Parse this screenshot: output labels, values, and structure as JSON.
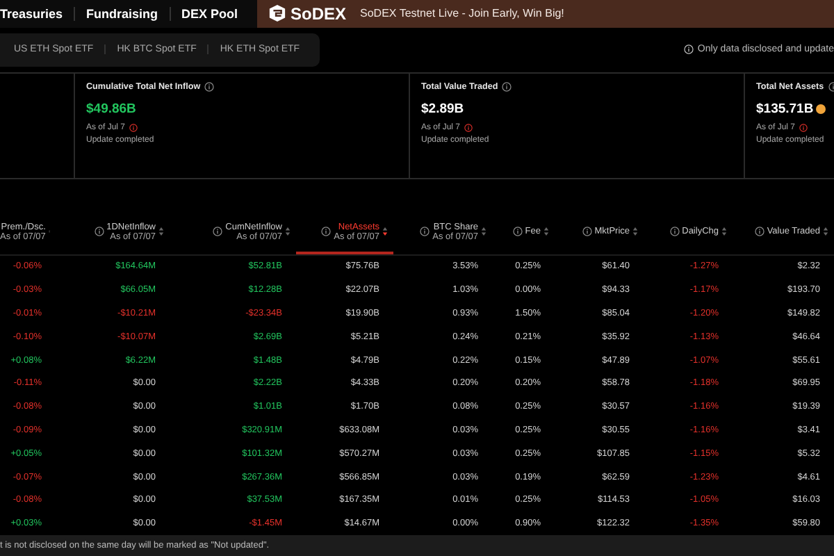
{
  "nav": {
    "items": [
      "Treasuries",
      "Fundraising",
      "DEX Pool"
    ]
  },
  "banner": {
    "brand": "SoDEX",
    "message": "SoDEX Testnet Live - Join Early, Win Big!"
  },
  "subtabs": [
    "US ETH Spot ETF",
    "HK BTC Spot ETF",
    "HK ETH Spot ETF"
  ],
  "notice": "Only data disclosed and update",
  "stats": [
    {
      "title": "Cumulative Total Net Inflow",
      "value": "$49.86B",
      "color": "#22c55e",
      "coin": false,
      "as_of": "As of Jul 7",
      "status": "Update completed"
    },
    {
      "title": "Total Value Traded",
      "value": "$2.89B",
      "color": "#ffffff",
      "coin": false,
      "as_of": "As of Jul 7",
      "status": "Update completed"
    },
    {
      "title": "Total Net Assets",
      "value": "$135.71B",
      "color": "#ffffff",
      "coin": true,
      "as_of": "As of Jul 7",
      "status": "Update completed"
    }
  ],
  "table": {
    "columns": [
      {
        "label": "Prem./Dsc.",
        "sub": "As of 07/07",
        "info": false,
        "selected": false
      },
      {
        "label": "1DNetInflow",
        "sub": "As of 07/07",
        "info": true,
        "selected": false
      },
      {
        "label": "CumNetInflow",
        "sub": "As of 07/07",
        "info": true,
        "selected": false
      },
      {
        "label": "NetAssets",
        "sub": "As of 07/07",
        "info": true,
        "selected": true
      },
      {
        "label": "BTC Share",
        "sub": "As of 07/07",
        "info": true,
        "selected": false
      },
      {
        "label": "Fee",
        "info": true,
        "selected": false
      },
      {
        "label": "MktPrice",
        "info": true,
        "selected": false
      },
      {
        "label": "DailyChg",
        "info": true,
        "selected": false
      },
      {
        "label": "Value Traded",
        "info": true,
        "selected": false
      }
    ],
    "rows": [
      {
        "cells": [
          {
            "text": "-0.06%",
            "color": "#e5312b"
          },
          {
            "text": "$164.64M",
            "color": "#22c55e"
          },
          {
            "text": "$52.81B",
            "color": "#22c55e"
          },
          {
            "text": "$75.76B",
            "color": "#d4d4d4"
          },
          {
            "text": "3.53%",
            "color": "#d4d4d4"
          },
          {
            "text": "0.25%",
            "color": "#d4d4d4"
          },
          {
            "text": "$61.40",
            "color": "#d4d4d4"
          },
          {
            "text": "-1.27%",
            "color": "#e5312b"
          },
          {
            "text": "$2.32",
            "color": "#d4d4d4"
          }
        ]
      },
      {
        "cells": [
          {
            "text": "-0.03%",
            "color": "#e5312b"
          },
          {
            "text": "$66.05M",
            "color": "#22c55e"
          },
          {
            "text": "$12.28B",
            "color": "#22c55e"
          },
          {
            "text": "$22.07B",
            "color": "#d4d4d4"
          },
          {
            "text": "1.03%",
            "color": "#d4d4d4"
          },
          {
            "text": "0.00%",
            "color": "#d4d4d4"
          },
          {
            "text": "$94.33",
            "color": "#d4d4d4"
          },
          {
            "text": "-1.17%",
            "color": "#e5312b"
          },
          {
            "text": "$193.70",
            "color": "#d4d4d4"
          }
        ]
      },
      {
        "cells": [
          {
            "text": "-0.01%",
            "color": "#e5312b"
          },
          {
            "text": "-$10.21M",
            "color": "#e5312b"
          },
          {
            "text": "-$23.34B",
            "color": "#e5312b"
          },
          {
            "text": "$19.90B",
            "color": "#d4d4d4"
          },
          {
            "text": "0.93%",
            "color": "#d4d4d4"
          },
          {
            "text": "1.50%",
            "color": "#d4d4d4"
          },
          {
            "text": "$85.04",
            "color": "#d4d4d4"
          },
          {
            "text": "-1.20%",
            "color": "#e5312b"
          },
          {
            "text": "$149.82",
            "color": "#d4d4d4"
          }
        ]
      },
      {
        "cells": [
          {
            "text": "-0.10%",
            "color": "#e5312b"
          },
          {
            "text": "-$10.07M",
            "color": "#e5312b"
          },
          {
            "text": "$2.69B",
            "color": "#22c55e"
          },
          {
            "text": "$5.21B",
            "color": "#d4d4d4"
          },
          {
            "text": "0.24%",
            "color": "#d4d4d4"
          },
          {
            "text": "0.21%",
            "color": "#d4d4d4"
          },
          {
            "text": "$35.92",
            "color": "#d4d4d4"
          },
          {
            "text": "-1.13%",
            "color": "#e5312b"
          },
          {
            "text": "$46.64",
            "color": "#d4d4d4"
          }
        ]
      },
      {
        "cells": [
          {
            "text": "+0.08%",
            "color": "#22c55e"
          },
          {
            "text": "$6.22M",
            "color": "#22c55e"
          },
          {
            "text": "$1.48B",
            "color": "#22c55e"
          },
          {
            "text": "$4.79B",
            "color": "#d4d4d4"
          },
          {
            "text": "0.22%",
            "color": "#d4d4d4"
          },
          {
            "text": "0.15%",
            "color": "#d4d4d4"
          },
          {
            "text": "$47.89",
            "color": "#d4d4d4"
          },
          {
            "text": "-1.07%",
            "color": "#e5312b"
          },
          {
            "text": "$55.61",
            "color": "#d4d4d4"
          }
        ]
      },
      {
        "cells": [
          {
            "text": "-0.11%",
            "color": "#e5312b"
          },
          {
            "text": "$0.00",
            "color": "#d4d4d4"
          },
          {
            "text": "$2.22B",
            "color": "#22c55e"
          },
          {
            "text": "$4.33B",
            "color": "#d4d4d4"
          },
          {
            "text": "0.20%",
            "color": "#d4d4d4"
          },
          {
            "text": "0.20%",
            "color": "#d4d4d4"
          },
          {
            "text": "$58.78",
            "color": "#d4d4d4"
          },
          {
            "text": "-1.18%",
            "color": "#e5312b"
          },
          {
            "text": "$69.95",
            "color": "#d4d4d4"
          }
        ]
      },
      {
        "cells": [
          {
            "text": "-0.08%",
            "color": "#e5312b"
          },
          {
            "text": "$0.00",
            "color": "#d4d4d4"
          },
          {
            "text": "$1.01B",
            "color": "#22c55e"
          },
          {
            "text": "$1.70B",
            "color": "#d4d4d4"
          },
          {
            "text": "0.08%",
            "color": "#d4d4d4"
          },
          {
            "text": "0.25%",
            "color": "#d4d4d4"
          },
          {
            "text": "$30.57",
            "color": "#d4d4d4"
          },
          {
            "text": "-1.16%",
            "color": "#e5312b"
          },
          {
            "text": "$19.39",
            "color": "#d4d4d4"
          }
        ]
      },
      {
        "cells": [
          {
            "text": "-0.09%",
            "color": "#e5312b"
          },
          {
            "text": "$0.00",
            "color": "#d4d4d4"
          },
          {
            "text": "$320.91M",
            "color": "#22c55e"
          },
          {
            "text": "$633.08M",
            "color": "#d4d4d4"
          },
          {
            "text": "0.03%",
            "color": "#d4d4d4"
          },
          {
            "text": "0.25%",
            "color": "#d4d4d4"
          },
          {
            "text": "$30.55",
            "color": "#d4d4d4"
          },
          {
            "text": "-1.16%",
            "color": "#e5312b"
          },
          {
            "text": "$3.41",
            "color": "#d4d4d4"
          }
        ]
      },
      {
        "cells": [
          {
            "text": "+0.05%",
            "color": "#22c55e"
          },
          {
            "text": "$0.00",
            "color": "#d4d4d4"
          },
          {
            "text": "$101.32M",
            "color": "#22c55e"
          },
          {
            "text": "$570.27M",
            "color": "#d4d4d4"
          },
          {
            "text": "0.03%",
            "color": "#d4d4d4"
          },
          {
            "text": "0.25%",
            "color": "#d4d4d4"
          },
          {
            "text": "$107.85",
            "color": "#d4d4d4"
          },
          {
            "text": "-1.15%",
            "color": "#e5312b"
          },
          {
            "text": "$5.32",
            "color": "#d4d4d4"
          }
        ]
      },
      {
        "cells": [
          {
            "text": "-0.07%",
            "color": "#e5312b"
          },
          {
            "text": "$0.00",
            "color": "#d4d4d4"
          },
          {
            "text": "$267.36M",
            "color": "#22c55e"
          },
          {
            "text": "$566.85M",
            "color": "#d4d4d4"
          },
          {
            "text": "0.03%",
            "color": "#d4d4d4"
          },
          {
            "text": "0.19%",
            "color": "#d4d4d4"
          },
          {
            "text": "$62.59",
            "color": "#d4d4d4"
          },
          {
            "text": "-1.23%",
            "color": "#e5312b"
          },
          {
            "text": "$4.61",
            "color": "#d4d4d4"
          }
        ]
      },
      {
        "cells": [
          {
            "text": "-0.08%",
            "color": "#e5312b"
          },
          {
            "text": "$0.00",
            "color": "#d4d4d4"
          },
          {
            "text": "$37.53M",
            "color": "#22c55e"
          },
          {
            "text": "$167.35M",
            "color": "#d4d4d4"
          },
          {
            "text": "0.01%",
            "color": "#d4d4d4"
          },
          {
            "text": "0.25%",
            "color": "#d4d4d4"
          },
          {
            "text": "$114.53",
            "color": "#d4d4d4"
          },
          {
            "text": "-1.05%",
            "color": "#e5312b"
          },
          {
            "text": "$16.03",
            "color": "#d4d4d4"
          }
        ]
      },
      {
        "cells": [
          {
            "text": "+0.03%",
            "color": "#22c55e"
          },
          {
            "text": "$0.00",
            "color": "#d4d4d4"
          },
          {
            "text": "-$1.45M",
            "color": "#e5312b"
          },
          {
            "text": "$14.67M",
            "color": "#d4d4d4"
          },
          {
            "text": "0.00%",
            "color": "#d4d4d4"
          },
          {
            "text": "0.90%",
            "color": "#d4d4d4"
          },
          {
            "text": "$122.32",
            "color": "#d4d4d4"
          },
          {
            "text": "-1.35%",
            "color": "#e5312b"
          },
          {
            "text": "$59.80",
            "color": "#d4d4d4"
          }
        ]
      }
    ]
  },
  "footer": "t is not disclosed on the same day will be marked as \"Not updated\"."
}
